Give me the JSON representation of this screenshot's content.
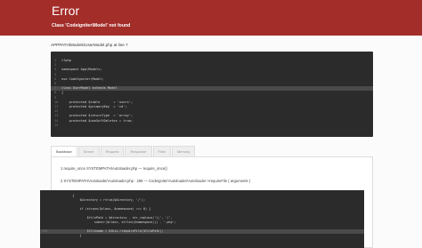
{
  "header": {
    "title": "Error",
    "message": "Class 'Codeigniter\\Model' not found"
  },
  "location": {
    "path": "APPPATH\\Models\\UserModel.php",
    "at_line_label": "at line",
    "line": "7"
  },
  "source": {
    "lines": [
      {
        "n": "1",
        "t": "<?php"
      },
      {
        "n": "2",
        "t": ""
      },
      {
        "n": "3",
        "t": "namespace App\\Models;"
      },
      {
        "n": "4",
        "t": ""
      },
      {
        "n": "5",
        "t": "use CodeIgniter\\Model;"
      },
      {
        "n": "6",
        "t": ""
      },
      {
        "n": "7",
        "t": "class UserModel extends Model"
      },
      {
        "n": "8",
        "t": "{"
      },
      {
        "n": "9",
        "t": ""
      },
      {
        "n": "10",
        "t": "    protected $table       = 'users';"
      },
      {
        "n": "11",
        "t": "    protected $primaryKey  = 'id';"
      },
      {
        "n": "12",
        "t": ""
      },
      {
        "n": "13",
        "t": "    protected $returnType  = 'array';"
      },
      {
        "n": "14",
        "t": "    protected $useSoftDeletes = true;"
      },
      {
        "n": "15",
        "t": ""
      }
    ],
    "highlight_index": 6
  },
  "tabs": [
    "Backtrace",
    "Server",
    "Request",
    "Response",
    "Files",
    "Memory"
  ],
  "backtrace": [
    {
      "num": "1",
      "text": "require_once SYSTEMPATH\\Autoloader.php  —  require_once()"
    },
    {
      "num": "2",
      "text": "SYSTEMPATH\\Autoloader\\Autoloader.php : 298  —  CodeIgniter\\Autoloader\\Autoloader->requireFile ( arguments )"
    }
  ],
  "trace_source": {
    "lines": [
      {
        "n": "",
        "t": "        {"
      },
      {
        "n": "",
        "t": "            $directory = rtrim($directory, '/');"
      },
      {
        "n": "",
        "t": ""
      },
      {
        "n": "",
        "t": "            if (strpos($class, $namespace) === 0) {"
      },
      {
        "n": "",
        "t": ""
      },
      {
        "n": "",
        "t": "                $filePath = $directory . str_replace('\\\\', '/',"
      },
      {
        "n": "",
        "t": "                    substr($class, strlen($namespace))) . '.php';"
      },
      {
        "n": "",
        "t": ""
      },
      {
        "n": "298",
        "t": "                $filename = $this->requireFile($filePath);"
      },
      {
        "n": "",
        "t": "            }"
      }
    ],
    "highlight_index": 8
  }
}
